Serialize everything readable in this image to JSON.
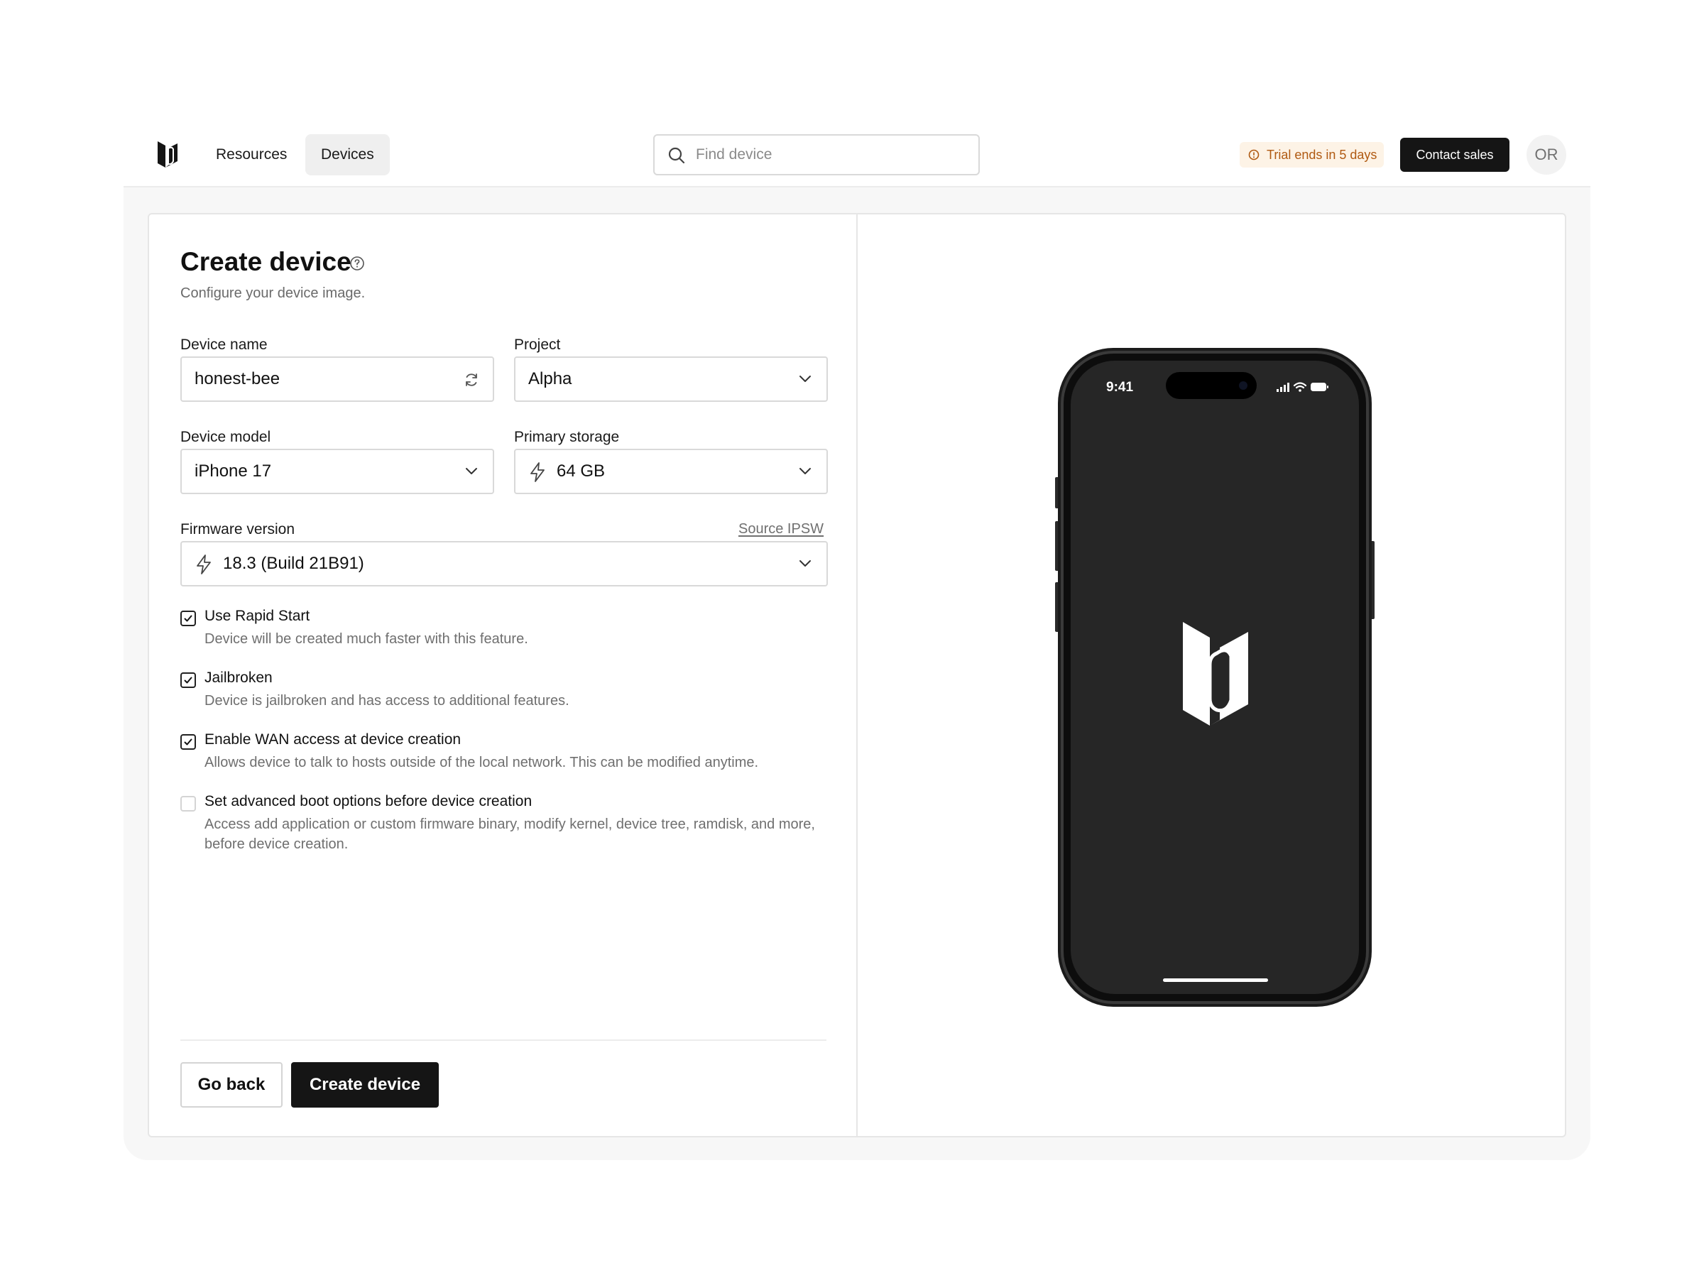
{
  "topbar": {
    "nav": {
      "resources": "Resources",
      "devices": "Devices"
    },
    "search": {
      "placeholder": "Find device"
    },
    "trial": "Trial ends in 5 days",
    "contact": "Contact sales",
    "avatar": "OR"
  },
  "form": {
    "title": "Create device",
    "subtitle": "Configure your device image.",
    "device_name": {
      "label": "Device name",
      "value": "honest-bee"
    },
    "project": {
      "label": "Project",
      "value": "Alpha"
    },
    "device_model": {
      "label": "Device model",
      "value": "iPhone 17"
    },
    "primary_storage": {
      "label": "Primary storage",
      "value": "64 GB"
    },
    "firmware": {
      "label": "Firmware version",
      "value": "18.3 (Build 21B91)",
      "source_link": "Source IPSW"
    },
    "options": [
      {
        "title": "Use Rapid Start",
        "desc": "Device will be created much faster with this feature.",
        "checked": true
      },
      {
        "title": "Jailbroken",
        "desc": "Device is jailbroken and has access to additional features.",
        "checked": true
      },
      {
        "title": "Enable WAN access at device creation",
        "desc": "Allows device to talk to hosts outside of the local network. This can be modified anytime.",
        "checked": true
      },
      {
        "title": "Set advanced boot options before device creation",
        "desc": "Access add application or custom firmware binary, modify kernel, device tree, ramdisk, and more, before device creation.",
        "checked": false
      }
    ],
    "buttons": {
      "back": "Go back",
      "create": "Create device"
    }
  },
  "preview": {
    "status_time": "9:41"
  },
  "colors": {
    "accent_dark": "#151515",
    "trial_text": "#b05a12",
    "trial_bg": "#fdf3e6",
    "phone_screen": "#262626"
  },
  "icons": [
    "brand-logo-icon",
    "search-icon",
    "alert-circle-icon",
    "help-circle-icon",
    "refresh-icon",
    "chevron-down-icon",
    "lightning-icon",
    "check-icon"
  ]
}
